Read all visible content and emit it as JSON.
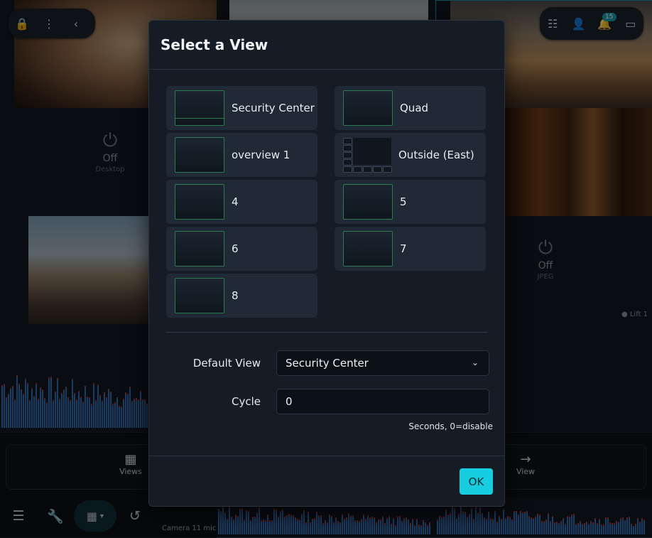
{
  "background": {
    "tiles": [
      {
        "name": "off-desktop",
        "status": "Off",
        "caption": "Desktop"
      },
      {
        "name": "off-jpeg",
        "status": "Off",
        "caption": "JPEG"
      }
    ],
    "lift_label": "Lift 1",
    "camera_label": "Camera 11 mic",
    "strip_items": [
      {
        "label": "Views",
        "icon": "grid-icon"
      },
      {
        "label": "View",
        "icon": "arrow-right-icon"
      }
    ],
    "notification_count": "15"
  },
  "modal": {
    "title": "Select a View",
    "views": [
      {
        "label": "Security Center",
        "thumb": "split"
      },
      {
        "label": "Quad",
        "thumb": "single"
      },
      {
        "label": "overview 1",
        "thumb": "single"
      },
      {
        "label": "Outside (East)",
        "thumb": "multi"
      },
      {
        "label": "4",
        "thumb": "single"
      },
      {
        "label": "5",
        "thumb": "single"
      },
      {
        "label": "6",
        "thumb": "single"
      },
      {
        "label": "7",
        "thumb": "single"
      },
      {
        "label": "8",
        "thumb": "single"
      }
    ],
    "default_view_label": "Default View",
    "default_view_value": "Security Center",
    "cycle_label": "Cycle",
    "cycle_value": "0",
    "cycle_hint": "Seconds, 0=disable",
    "ok_label": "OK"
  },
  "colors": {
    "accent": "#19cde0",
    "thumb_border": "#2f7a52"
  }
}
